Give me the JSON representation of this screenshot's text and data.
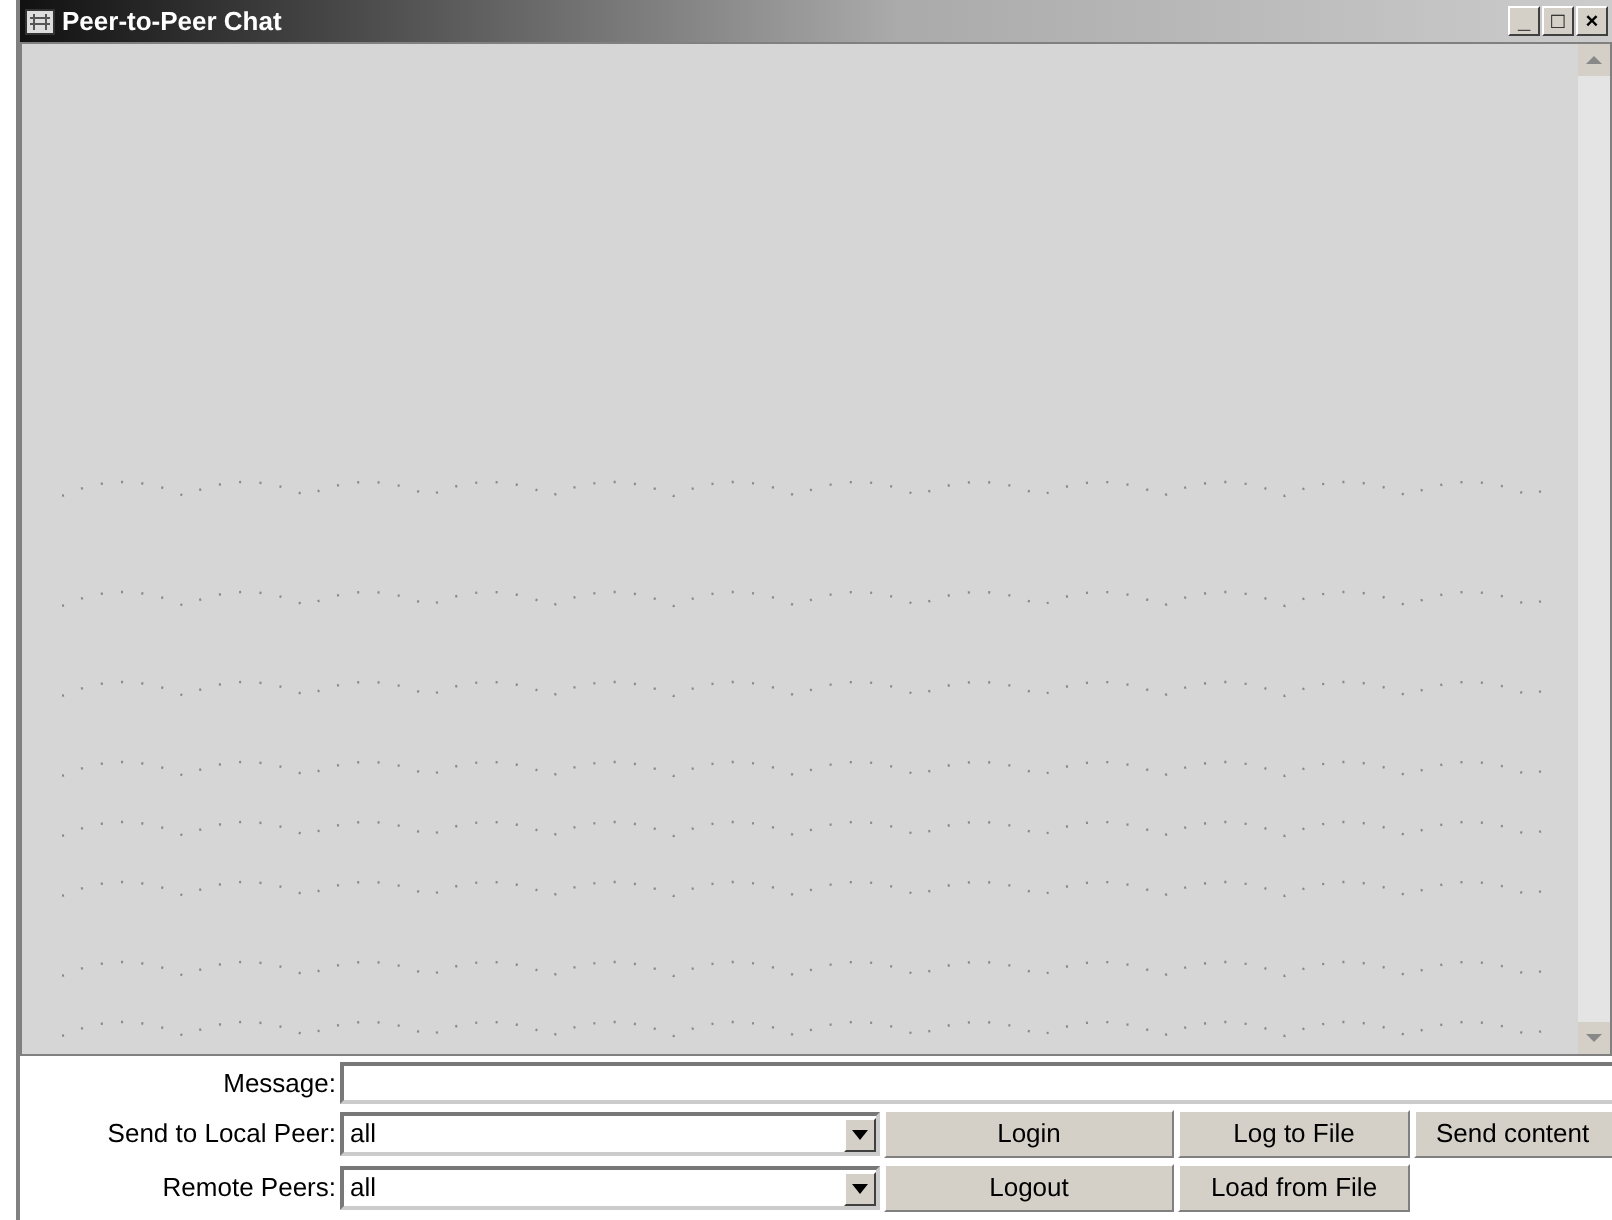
{
  "window": {
    "title": "Peer-to-Peer Chat",
    "controls": [
      "_",
      "□",
      "×"
    ]
  },
  "form": {
    "message": {
      "label": "Message:"
    },
    "rows": [
      {
        "label": "Send to Local Peer:",
        "value": "all",
        "buttons": [
          "Login",
          "Log to File",
          "Send content"
        ]
      },
      {
        "label": "Remote Peers:",
        "value": "all",
        "buttons": [
          "Logout",
          "Load from File"
        ]
      }
    ]
  }
}
